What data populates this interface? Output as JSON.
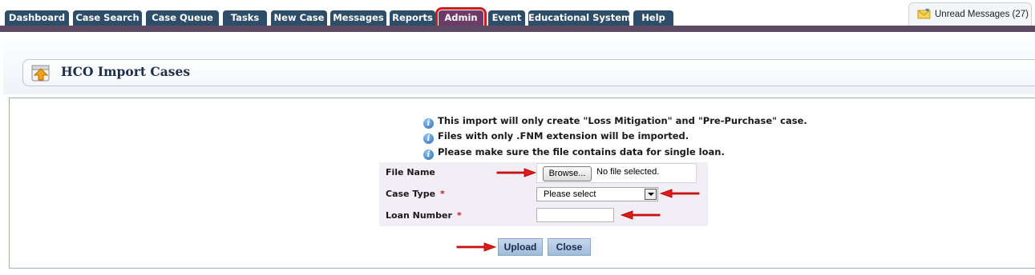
{
  "nav": {
    "tabs": [
      {
        "label": "Dashboard"
      },
      {
        "label": "Case Search"
      },
      {
        "label": "Case Queue"
      },
      {
        "label": "Tasks"
      },
      {
        "label": "New Case"
      },
      {
        "label": "Messages"
      },
      {
        "label": "Reports"
      },
      {
        "label": "Admin",
        "active": true
      },
      {
        "label": "Event"
      },
      {
        "label": "Educational System"
      },
      {
        "label": "Help"
      }
    ],
    "unread_messages": "Unread Messages (27)"
  },
  "page": {
    "title": "HCO Import Cases"
  },
  "info_messages": [
    "This import will only create \"Loss Mitigation\" and \"Pre-Purchase\" case.",
    "Files with only .FNM extension will be imported.",
    "Please make sure the file contains data for single loan."
  ],
  "form": {
    "file_name_label": "File Name",
    "browse_label": "Browse...",
    "no_file_text": "No file selected.",
    "case_type_label": "Case Type",
    "case_type_value": "Please select",
    "loan_number_label": "Loan Number",
    "loan_number_value": "",
    "required_marker": "*"
  },
  "actions": {
    "upload_label": "Upload",
    "close_label": "Close"
  },
  "colors": {
    "tab_bg": "#2d4d69",
    "tab_active_bg": "#6d3b67",
    "highlight_red": "#d01b1b",
    "nav_line": "#5d4a63",
    "button_bg": "#b4cbe6"
  }
}
